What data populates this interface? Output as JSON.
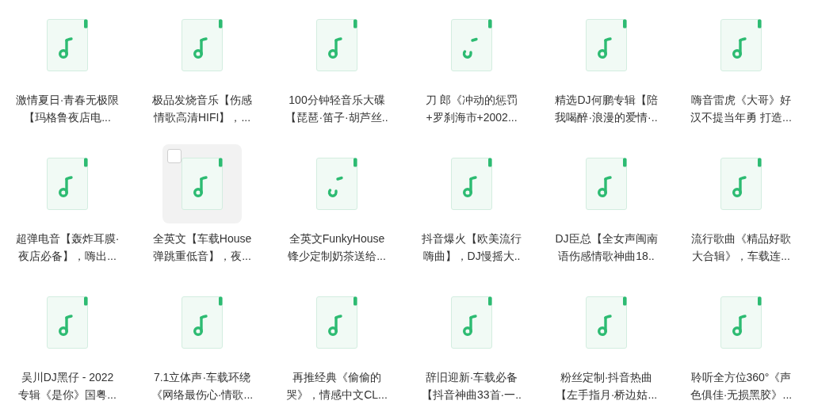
{
  "files": [
    {
      "title_lines": [
        "激情夏日·青春无极限",
        "【玛格鲁夜店电..."
      ],
      "kind": "note",
      "hovered": false
    },
    {
      "title_lines": [
        "极品发烧音乐【伤感",
        "情歌高清HIFI】，..."
      ],
      "kind": "note",
      "hovered": false
    },
    {
      "title_lines": [
        "100分钟轻音乐大碟",
        "【琵琶·笛子·胡芦丝.."
      ],
      "kind": "note",
      "hovered": false
    },
    {
      "title_lines": [
        "刀 郎《冲动的惩罚",
        "+罗刹海市+2002..."
      ],
      "kind": "loading",
      "hovered": false
    },
    {
      "title_lines": [
        "精选DJ何鹏专辑【陪",
        "我喝醉·浪漫的爱情·.."
      ],
      "kind": "note",
      "hovered": false
    },
    {
      "title_lines": [
        "嗨音雷虎《大哥》好",
        "汉不提当年勇 打造..."
      ],
      "kind": "note",
      "hovered": false
    },
    {
      "title_lines": [
        "超弹电音【轰炸耳膜·",
        "夜店必备】，嗨出..."
      ],
      "kind": "note",
      "hovered": false
    },
    {
      "title_lines": [
        "全英文【车载House",
        "弹跳重低音】，夜..."
      ],
      "kind": "note",
      "hovered": true,
      "checked": false
    },
    {
      "title_lines": [
        "全英文FunkyHouse",
        "锋少定制奶茶送给..."
      ],
      "kind": "loading",
      "hovered": false
    },
    {
      "title_lines": [
        "抖音爆火【欧美流行",
        "嗨曲】，DJ慢摇大.."
      ],
      "kind": "note",
      "hovered": false
    },
    {
      "title_lines": [
        "DJ臣总【全女声闽南",
        "语伤感情歌神曲18.."
      ],
      "kind": "note",
      "hovered": false
    },
    {
      "title_lines": [
        "流行歌曲《精品好歌",
        "大合辑》，车载连..."
      ],
      "kind": "note",
      "hovered": false
    },
    {
      "title_lines": [
        "吴川DJ黑仔 - 2022",
        "专辑《是你》国粤..."
      ],
      "kind": "note",
      "hovered": false
    },
    {
      "title_lines": [
        "7.1立体声·车载环绕",
        "《网络最伤心·情歌..."
      ],
      "kind": "note",
      "hovered": false
    },
    {
      "title_lines": [
        "再推经典《偷偷的",
        "哭》，情感中文CL..."
      ],
      "kind": "note",
      "hovered": false
    },
    {
      "title_lines": [
        "辞旧迎新·车载必备",
        "【抖音神曲33首·一.."
      ],
      "kind": "note",
      "hovered": false
    },
    {
      "title_lines": [
        "粉丝定制·抖音热曲",
        "【左手指月·桥边姑..."
      ],
      "kind": "note",
      "hovered": false
    },
    {
      "title_lines": [
        "聆听全方位360°《声",
        "色俱佳·无损黑胶》..."
      ],
      "kind": "note",
      "hovered": false
    }
  ]
}
